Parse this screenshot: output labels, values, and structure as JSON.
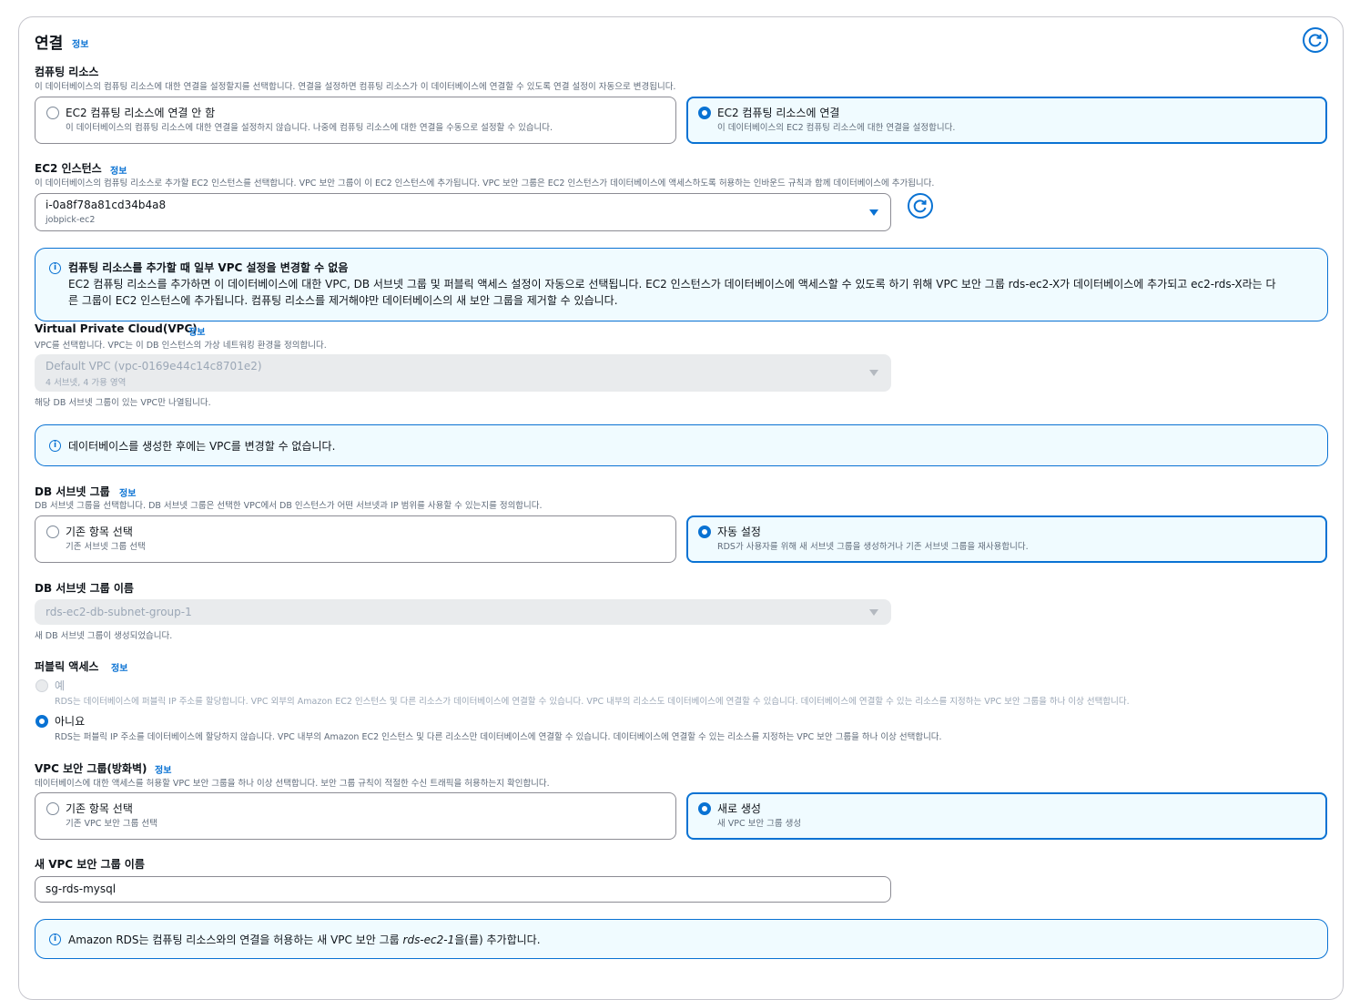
{
  "header": {
    "title": "연결",
    "info": "정보"
  },
  "compute": {
    "label": "컴퓨팅 리소스",
    "desc": "이 데이터베이스의 컴퓨팅 리소스에 대한 연결을 설정할지를 선택합니다. 연결을 설정하면 컴퓨팅 리소스가 이 데이터베이스에 연결할 수 있도록 연결 설정이 자동으로 변경됩니다.",
    "opt1_label": "EC2 컴퓨팅 리소스에 연결 안 함",
    "opt1_desc": "이 데이터베이스의 컴퓨팅 리소스에 대한 연결을 설정하지 않습니다. 나중에 컴퓨팅 리소스에 대한 연결을 수동으로 설정할 수 있습니다.",
    "opt2_label": "EC2 컴퓨팅 리소스에 연결",
    "opt2_desc": "이 데이터베이스의 EC2 컴퓨팅 리소스에 대한 연결을 설정합니다."
  },
  "ec2": {
    "label": "EC2 인스턴스",
    "info": "정보",
    "desc": "이 데이터베이스의 컴퓨팅 리소스로 추가할 EC2 인스턴스를 선택합니다. VPC 보안 그룹이 이 EC2 인스턴스에 추가됩니다. VPC 보안 그룹은 EC2 인스턴스가 데이터베이스에 액세스하도록 허용하는 인바운드 규칙과 함께 데이터베이스에 추가됩니다.",
    "value": "i-0a8f78a81cd34b4a8",
    "subvalue": "jobpick-ec2"
  },
  "alert1": {
    "title": "컴퓨팅 리소스를 추가할 때 일부 VPC 설정을 변경할 수 없음",
    "line1": "EC2 컴퓨팅 리소스를 추가하면 이 데이터베이스에 대한 VPC, DB 서브넷 그룹 및 퍼블릭 액세스 설정이 자동으로 선택됩니다. EC2 인스턴스가 데이터베이스에 액세스할 수 있도록 하기 위해 VPC 보안 그룹 rds-ec2-X가 데이터베이스에 추가되고 ec2-rds-X라는 다",
    "line2": "른 그룹이 EC2 인스턴스에 추가됩니다. 컴퓨팅 리소스를 제거해야만 데이터베이스의 새 보안 그룹을 제거할 수 있습니다."
  },
  "vpc": {
    "label": "Virtual Private Cloud(VPC)",
    "info": "정보",
    "desc": "VPC를 선택합니다. VPC는 이 DB 인스턴스의 가상 네트워킹 환경을 정의합니다.",
    "value": "Default VPC (vpc-0169e44c14c8701e2)",
    "subvalue": "4 서브넷, 4 가용 영역",
    "hint": "해당 DB 서브넷 그룹이 있는 VPC만 나열됩니다."
  },
  "alert2": {
    "text": "데이터베이스를 생성한 후에는 VPC를 변경할 수 없습니다."
  },
  "subnet": {
    "label": "DB 서브넷 그룹",
    "info": "정보",
    "desc": "DB 서브넷 그룹을 선택합니다. DB 서브넷 그룹은 선택한 VPC에서 DB 인스턴스가 어떤 서브넷과 IP 범위를 사용할 수 있는지를 정의합니다.",
    "opt1_label": "기존 항목 선택",
    "opt1_desc": "기존 서브넷 그룹 선택",
    "opt2_label": "자동 설정",
    "opt2_desc": "RDS가 사용자를 위해 새 서브넷 그룹을 생성하거나 기존 서브넷 그룹을 재사용합니다."
  },
  "subnet_name": {
    "label": "DB 서브넷 그룹 이름",
    "value": "rds-ec2-db-subnet-group-1",
    "hint": "새 DB 서브넷 그룹이 생성되었습니다."
  },
  "public": {
    "label": "퍼블릭 액세스",
    "info": "정보",
    "yes_label": "예",
    "yes_desc": "RDS는 데이터베이스에 퍼블릭 IP 주소를 할당합니다. VPC 외부의 Amazon EC2 인스턴스 및 다른 리소스가 데이터베이스에 연결할 수 있습니다. VPC 내부의 리소스도 데이터베이스에 연결할 수 있습니다. 데이터베이스에 연결할 수 있는 리소스를 지정하는 VPC 보안 그룹을 하나 이상 선택합니다.",
    "no_label": "아니요",
    "no_desc": "RDS는 퍼블릭 IP 주소를 데이터베이스에 할당하지 않습니다. VPC 내부의 Amazon EC2 인스턴스 및 다른 리소스만 데이터베이스에 연결할 수 있습니다. 데이터베이스에 연결할 수 있는 리소스를 지정하는 VPC 보안 그룹을 하나 이상 선택합니다."
  },
  "sg": {
    "label": "VPC 보안 그룹(방화벽)",
    "info": "정보",
    "desc": "데이터베이스에 대한 액세스를 허용할 VPC 보안 그룹을 하나 이상 선택합니다. 보안 그룹 규칙이 적절한 수신 트래픽을 허용하는지 확인합니다.",
    "opt1_label": "기존 항목 선택",
    "opt1_desc": "기존 VPC 보안 그룹 선택",
    "opt2_label": "새로 생성",
    "opt2_desc": "새 VPC 보안 그룹 생성"
  },
  "sg_name": {
    "label": "새 VPC 보안 그룹 이름",
    "value": "sg-rds-mysql"
  },
  "alert3": {
    "prefix": "Amazon RDS는 컴퓨팅 리소스와의 연결을 허용하는 새 VPC 보안 그룹 ",
    "name": "rds-ec2-1",
    "suffix": "을(를) 추가합니다."
  },
  "colors": {
    "accent": "#0972d3",
    "selected_bg": "#f0fbff",
    "border": "#8c8c94"
  }
}
